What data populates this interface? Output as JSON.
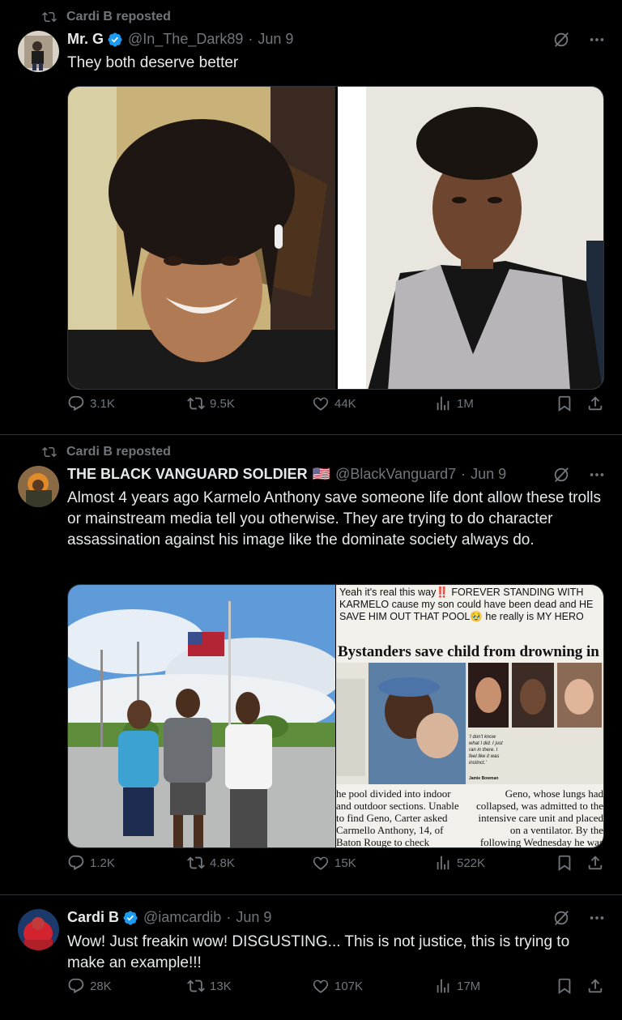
{
  "tweets": [
    {
      "repost_label": "Cardi B reposted",
      "name": "Mr. G",
      "handle": "@In_The_Dark89",
      "date": "Jun 9",
      "text": "They both deserve better",
      "stats": {
        "replies": "3.1K",
        "reposts": "9.5K",
        "likes": "44K",
        "views": "1M"
      }
    },
    {
      "repost_label": "Cardi B reposted",
      "name": "THE BLACK VANGUARD SOLDIER",
      "flag": "🇺🇸",
      "handle": "@BlackVanguard7",
      "date": "Jun 9",
      "text": "Almost 4 years ago Karmelo Anthony save someone life dont allow these trolls  or mainstream media tell you otherwise. They are trying to do character assassination against  his image like the dominate society always do.",
      "media_caption": "Yeah it's real this way‼️ FOREVER STANDING WITH KARMELO cause my son could have been dead and HE SAVE HIM OUT THAT POOL🥹 he really is MY HERO",
      "newspaper": {
        "headline": "Bystanders save child from drowning in pool",
        "quote": "'I don't know what I did. I just ran in there. I feel like it was instinct.'",
        "byline": "Jamie Bowman",
        "col1": "he pool divided into indoor and outdoor sections. Unable to find Geno, Carter asked Carmello Anthony, 14, of Baton Rouge to check",
        "col2": "Geno, whose lungs had collapsed, was admitted to the intensive care unit and placed on a ventilator. By the following Wednesday he was off the vent and starting"
      },
      "stats": {
        "replies": "1.2K",
        "reposts": "4.8K",
        "likes": "15K",
        "views": "522K"
      }
    },
    {
      "name": "Cardi B",
      "handle": "@iamcardib",
      "date": "Jun 9",
      "text": "Wow! Just freakin wow! DISGUSTING... This is not justice, this is trying to make an example!!!",
      "stats": {
        "replies": "28K",
        "reposts": "13K",
        "likes": "107K",
        "views": "17M"
      }
    }
  ],
  "colors": {
    "background": "#000000",
    "text": "#e7e9ea",
    "muted": "#71767b",
    "verified": "#1d9bf0",
    "divider": "#2f3336"
  },
  "icons": [
    "repost-icon",
    "verified-badge-icon",
    "grok-icon",
    "more-icon",
    "reply-icon",
    "like-icon",
    "views-icon",
    "bookmark-icon",
    "share-icon"
  ]
}
